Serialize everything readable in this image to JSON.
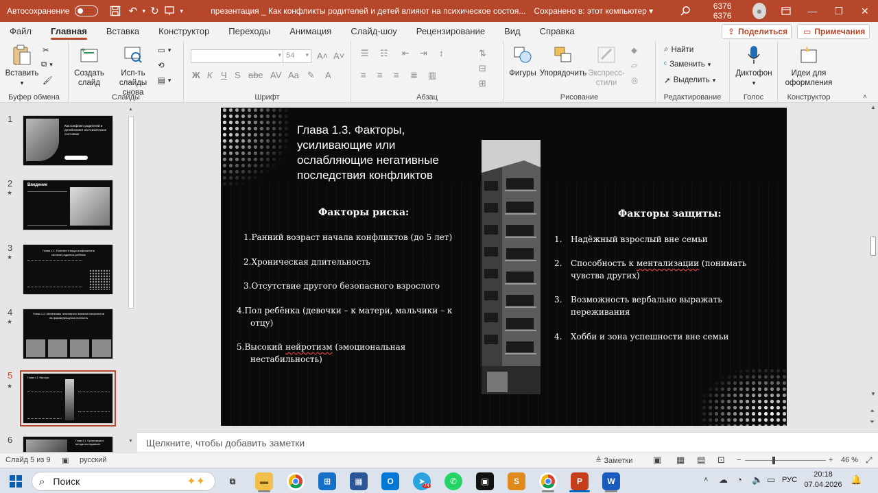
{
  "titlebar": {
    "autosave_label": "Автосохранение",
    "doc_title": "презентация _ Как конфликты родителей и детей влияют на психическое состоя...",
    "saved_status": "Сохранено в: этот компьютер",
    "user_name": "6376 6376"
  },
  "tabs": [
    "Файл",
    "Главная",
    "Вставка",
    "Конструктор",
    "Переходы",
    "Анимация",
    "Слайд-шоу",
    "Рецензирование",
    "Вид",
    "Справка"
  ],
  "active_tab": "Главная",
  "share_label": "Поделиться",
  "comments_label": "Примечания",
  "ribbon": {
    "paste_label": "Вставить",
    "clipboard_group": "Буфер обмена",
    "new_slide_label": "Создать слайд",
    "reuse_label": "Исп-ть слайды снова",
    "slides_group": "Слайды",
    "font_size": "54",
    "font_group": "Шрифт",
    "paragraph_group": "Абзац",
    "shapes_label": "Фигуры",
    "arrange_label": "Упорядочить",
    "quick_styles_label": "Экспресс-стили",
    "drawing_group": "Рисование",
    "find_label": "Найти",
    "replace_label": "Заменить",
    "select_label": "Выделить",
    "editing_group": "Редактирование",
    "dictate_label": "Диктофон",
    "voice_group": "Голос",
    "designer_label": "Идеи для оформления",
    "designer_group": "Конструктор"
  },
  "thumbnails": [
    {
      "num": "1",
      "star": false,
      "caption": "Как конфликт родителей и детей влияет на психическое состояние"
    },
    {
      "num": "2",
      "star": true,
      "caption": "Введение"
    },
    {
      "num": "3",
      "star": true,
      "caption": "Глава 1.1. Понятие и виды конфликтов в системе родитель-ребёнок"
    },
    {
      "num": "4",
      "star": true,
      "caption": "Глава 1.2. Механизмы негативного влияния конфликтов на формирующуюся личность"
    },
    {
      "num": "5",
      "star": true,
      "caption": "Глава 1.3. Факторы"
    },
    {
      "num": "6",
      "star": false,
      "caption": "Глава 2.1. Организация и методы исследования"
    }
  ],
  "slide": {
    "title": "Глава 1.3. Факторы, усиливающие или ослабляющие негативные последствия конфликтов",
    "risk_heading": "Факторы риска:",
    "risk_items": [
      {
        "n": "1.",
        "text": "Ранний возраст начала конфликтов (до 5 лет)"
      },
      {
        "n": "2.",
        "text": "Хроническая длительность"
      },
      {
        "n": "3.",
        "text": "Отсутствие другого безопасного взрослого"
      },
      {
        "n": "4.",
        "text": "Пол ребёнка (девочки – к матери, мальчики – к отцу)"
      },
      {
        "n": "5.",
        "text": "Высокий нейротизм (эмоциональная нестабильность)"
      }
    ],
    "protect_heading": "Факторы защиты:",
    "protect_items": [
      {
        "n": "1.",
        "text": "Надёжный взрослый вне семьи"
      },
      {
        "n": "2.",
        "text": "Способность к ментализации (понимать чувства других)"
      },
      {
        "n": "3.",
        "text": "Возможность вербально выражать переживания"
      },
      {
        "n": "4.",
        "text": "Хобби и зона успешности вне семьи"
      }
    ]
  },
  "notes_placeholder": "Щелкните, чтобы добавить заметки",
  "statusbar": {
    "slide_info": "Слайд 5 из 9",
    "language": "русский",
    "notes_label": "Заметки",
    "zoom": "46 %"
  },
  "taskbar": {
    "search_label": "Поиск",
    "language": "РУС",
    "time": "20:18",
    "date": "07.04.2026",
    "telegram_badge": "74"
  },
  "colors": {
    "accent": "#b7472a",
    "slide_bg": "#0a0a0a"
  }
}
